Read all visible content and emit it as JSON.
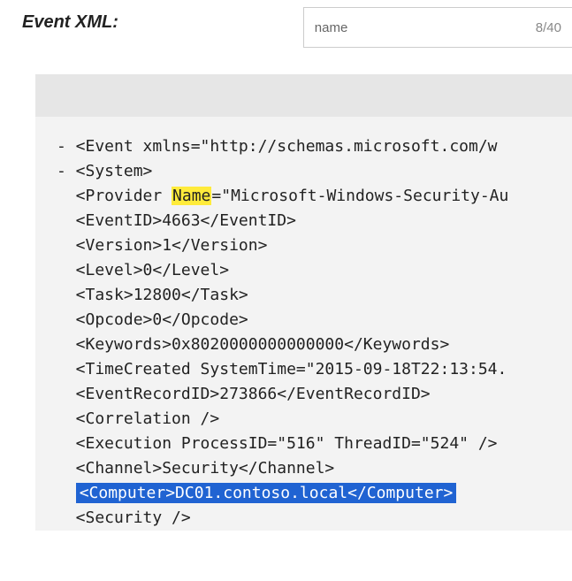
{
  "header": {
    "title": "Event XML:",
    "search_value": "name",
    "match_counter": "8/40"
  },
  "code": {
    "line1_prefix": "- <Event xmlns=\"http://schemas.microsoft.com/w",
    "line2": "- <System>",
    "line3_a": "  <Provider ",
    "line3_hl": "Name",
    "line3_b": "=\"Microsoft-Windows-Security-Au",
    "line4": "  <EventID>4663</EventID>",
    "line5": "  <Version>1</Version>",
    "line6": "  <Level>0</Level>",
    "line7": "  <Task>12800</Task>",
    "line8": "  <Opcode>0</Opcode>",
    "line9": "  <Keywords>0x8020000000000000</Keywords>",
    "line10": "  <TimeCreated SystemTime=\"2015-09-18T22:13:54.",
    "line11": "  <EventRecordID>273866</EventRecordID>",
    "line12": "  <Correlation />",
    "line13": "  <Execution ProcessID=\"516\" ThreadID=\"524\" />",
    "line14": "  <Channel>Security</Channel>",
    "line15_indent": "  ",
    "line15_hl": "<Computer>DC01.contoso.local</Computer>",
    "line16": "  <Security />"
  }
}
